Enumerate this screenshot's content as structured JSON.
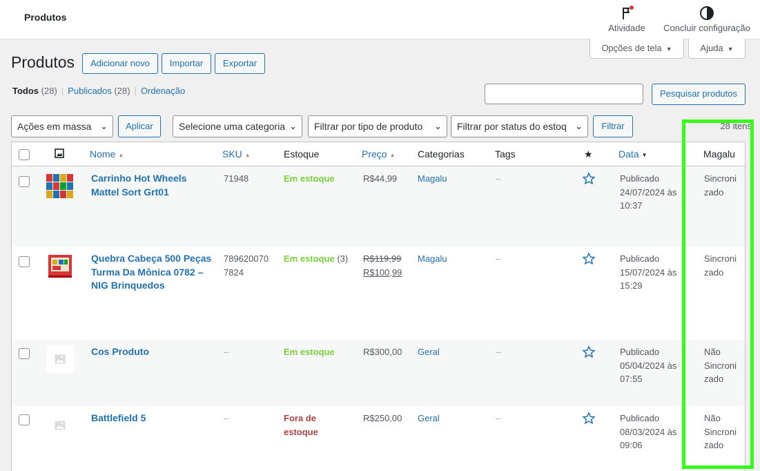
{
  "topbar": {
    "breadcrumb": "Produtos",
    "activity_label": "Atividade",
    "setup_label": "Concluir configuração"
  },
  "screen_tabs": {
    "options_label": "Opções de tela",
    "help_label": "Ajuda"
  },
  "page": {
    "title": "Produtos",
    "add_new": "Adicionar novo",
    "import": "Importar",
    "export": "Exportar"
  },
  "views": {
    "all_label": "Todos",
    "all_count": "(28)",
    "published_label": "Publicados",
    "published_count": "(28)",
    "sorting_label": "Ordenação"
  },
  "search": {
    "value": "",
    "button": "Pesquisar produtos"
  },
  "filters": {
    "bulk_actions": "Ações em massa",
    "apply": "Aplicar",
    "category": "Selecione uma categoria",
    "product_type": "Filtrar por tipo de produto",
    "stock_status": "Filtrar por status do estoq",
    "filter_button": "Filtrar",
    "items_count": "28 itens"
  },
  "columns": {
    "name": "Nome",
    "sku": "SKU",
    "stock": "Estoque",
    "price": "Preço",
    "categories": "Categorias",
    "tags": "Tags",
    "date": "Data",
    "magalu": "Magalu"
  },
  "products": [
    {
      "name_line1": "Carrinho Hot Wheels",
      "name_line2": "Mattel Sort Grt01",
      "name_line3": "",
      "sku_line1": "71948",
      "sku_line2": "",
      "stock": "Em estoque",
      "stock_qty": "",
      "price_regular": "R$44,99",
      "price_sale": "",
      "category": "Magalu",
      "tags": "–",
      "date_status": "Publicado",
      "date_line": "24/07/2024 às",
      "time": "10:37",
      "magalu_line1": "Sincroni",
      "magalu_line2": "zado",
      "magalu_line3": ""
    },
    {
      "name_line1": "Quebra Cabeça 500 Peças",
      "name_line2": "Turma Da Mônica 0782 –",
      "name_line3": "NIG Brinquedos",
      "sku_line1": "789620070",
      "sku_line2": "7824",
      "stock": "Em estoque",
      "stock_qty": "(3)",
      "price_regular": "R$119,99",
      "price_sale": "R$100,99",
      "category": "Magalu",
      "tags": "–",
      "date_status": "Publicado",
      "date_line": "15/07/2024 às",
      "time": "15:29",
      "magalu_line1": "Sincroni",
      "magalu_line2": "zado",
      "magalu_line3": ""
    },
    {
      "name_line1": "Cos Produto",
      "name_line2": "",
      "name_line3": "",
      "sku_line1": "–",
      "sku_line2": "",
      "stock": "Em estoque",
      "stock_qty": "",
      "price_regular": "R$300,00",
      "price_sale": "",
      "category": "Geral",
      "tags": "–",
      "date_status": "Publicado",
      "date_line": "05/04/2024 às",
      "time": "07:55",
      "magalu_line1": "Não",
      "magalu_line2": "Sincroni",
      "magalu_line3": "zado"
    },
    {
      "name_line1": "Battlefield 5",
      "name_line2": "",
      "name_line3": "",
      "sku_line1": "–",
      "sku_line2": "",
      "stock_out_line1": "Fora de",
      "stock_out_line2": "estoque",
      "price_regular": "R$250,00",
      "price_sale": "",
      "category": "Geral",
      "tags": "–",
      "date_status": "Publicado",
      "date_line": "08/03/2024 às",
      "time": "09:06",
      "magalu_line1": "Não",
      "magalu_line2": "Sincroni",
      "magalu_line3": "zado"
    }
  ],
  "colors": {
    "link": "#2271b1",
    "in_stock": "#7ad03a",
    "out_of_stock": "#aa4444",
    "highlight": "#35ff19",
    "notification_dot": "#d63638"
  },
  "icons": {
    "activity": "flag-icon",
    "setup": "half-circle-icon",
    "featured": "star-icon",
    "thumbnail_header": "image-icon"
  }
}
